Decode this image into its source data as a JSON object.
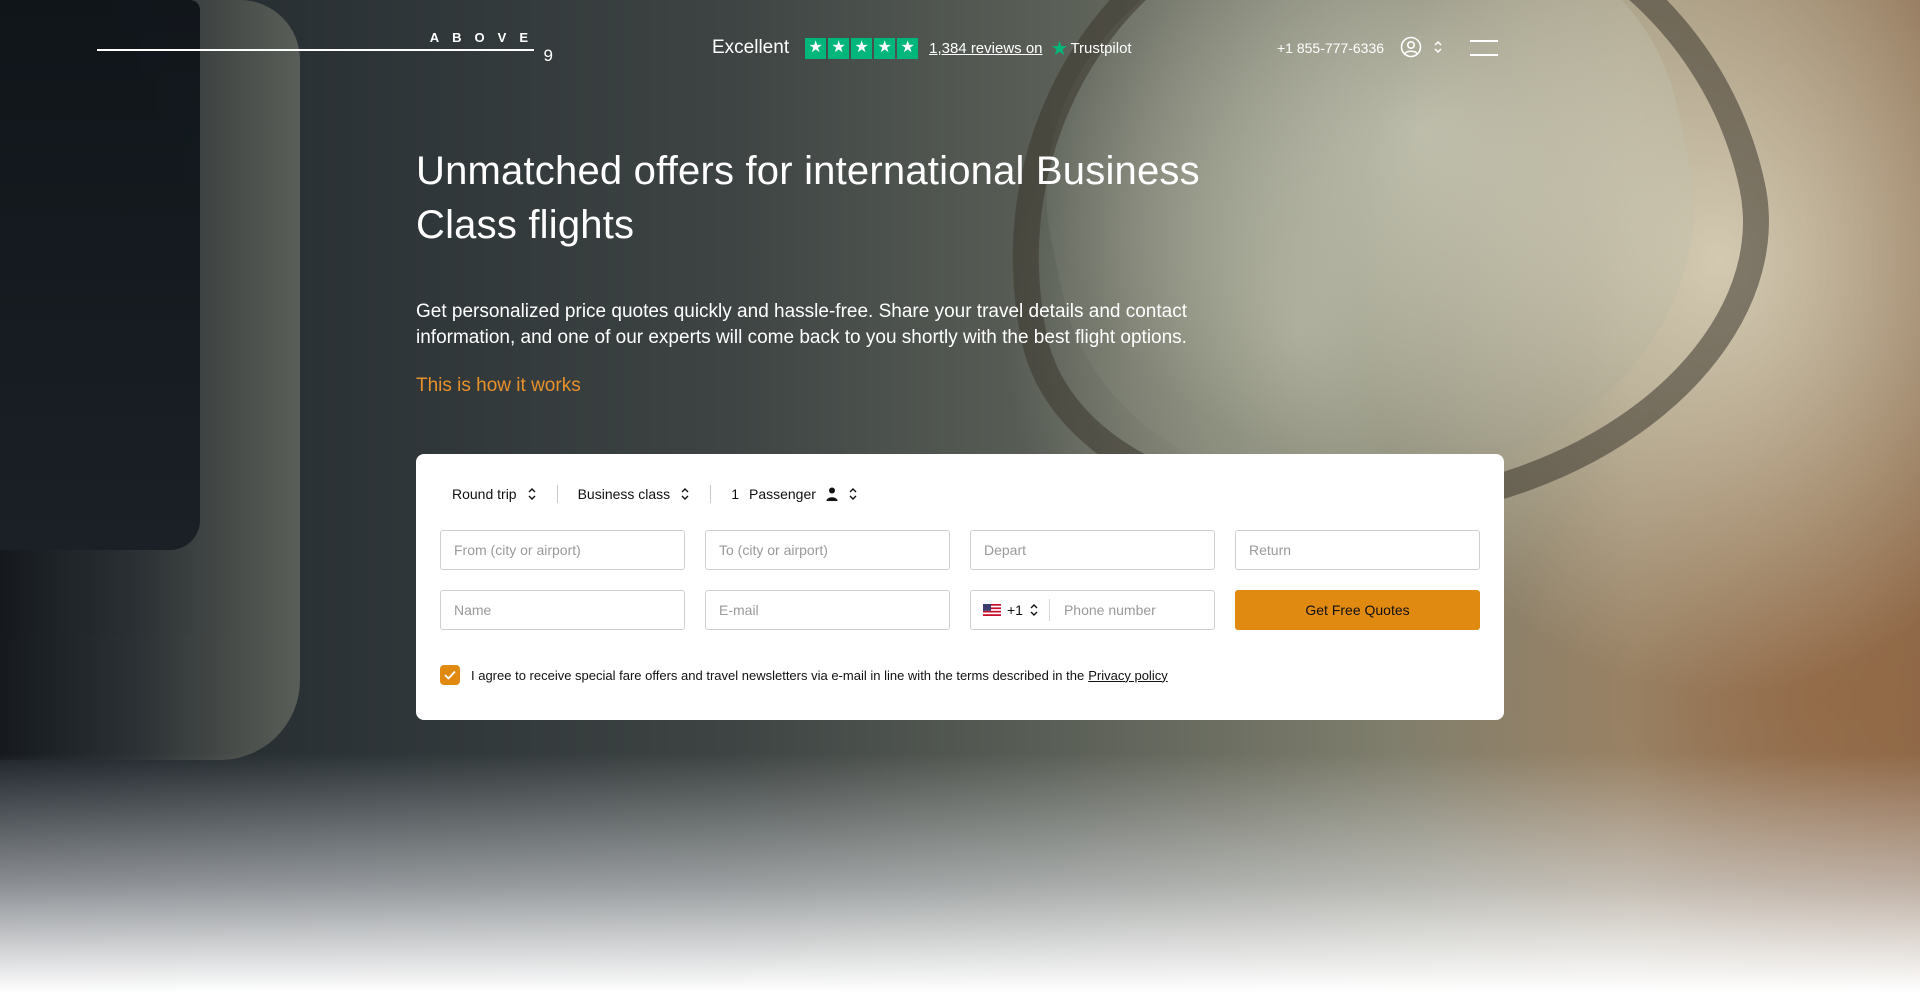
{
  "brand": {
    "word": "ABOVE",
    "number": "9"
  },
  "rating": {
    "label": "Excellent",
    "stars": 5,
    "reviews_link": "1,384 reviews on",
    "provider": "Trustpilot",
    "star_color": "#00b67a"
  },
  "header": {
    "phone": "+1 855-777-6336",
    "account_icon": "user-circle-icon",
    "menu_icon": "hamburger-icon"
  },
  "hero": {
    "title": "Unmatched offers for international Business Class flights",
    "subtitle": "Get personalized price quotes quickly and hassle-free. Share your travel details and contact information, and one of our experts will come back to you shortly with the best flight options.",
    "how_it_works": "This is how it works"
  },
  "form": {
    "trip_type": "Round trip",
    "cabin_class": "Business class",
    "passengers_count": "1",
    "passengers_label": "Passenger",
    "from_placeholder": "From (city or airport)",
    "to_placeholder": "To (city or airport)",
    "depart_placeholder": "Depart",
    "return_placeholder": "Return",
    "name_placeholder": "Name",
    "email_placeholder": "E-mail",
    "phone_country_code": "+1",
    "phone_placeholder": "Phone number",
    "submit_label": "Get Free Quotes",
    "consent_text": "I agree to receive special fare offers and travel newsletters via e-mail in line with the terms described in the",
    "privacy_link": "Privacy policy",
    "consent_checked": true
  },
  "colors": {
    "accent": "#e08a12",
    "link_orange": "#e8912a",
    "trustpilot_green": "#00b67a"
  }
}
